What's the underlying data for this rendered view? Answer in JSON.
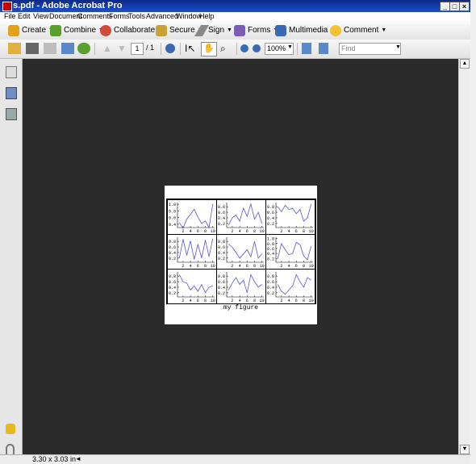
{
  "window": {
    "title": "s.pdf - Adobe Acrobat Pro"
  },
  "menu": [
    "File",
    "Edit",
    "View",
    "Document",
    "Comments",
    "Forms",
    "Tools",
    "Advanced",
    "Window",
    "Help"
  ],
  "toolbar1": {
    "create": "Create",
    "combine": "Combine",
    "collaborate": "Collaborate",
    "secure": "Secure",
    "sign": "Sign",
    "forms": "Forms",
    "multimedia": "Multimedia",
    "comment": "Comment"
  },
  "toolbar2": {
    "page_current": "1",
    "page_total": "/ 1",
    "zoom": "100%",
    "find_placeholder": "Find"
  },
  "status": {
    "page_size": "3.30 x 3.03 in"
  },
  "figure": {
    "caption": "my figure",
    "xticks": [
      "2",
      "4",
      "6",
      "8",
      "10"
    ],
    "line_color": "#5555cc"
  },
  "chart_data": [
    {
      "type": "line",
      "x": [
        1,
        2,
        3,
        4,
        5,
        6,
        7,
        8,
        9,
        10
      ],
      "values": [
        0.45,
        0.28,
        0.55,
        0.7,
        0.85,
        0.62,
        0.42,
        0.5,
        0.3,
        1.0
      ],
      "yticks": [
        "1.0",
        "0.8",
        "0.6",
        "0.4"
      ],
      "ylim": [
        0.3,
        1.05
      ]
    },
    {
      "type": "line",
      "x": [
        1,
        2,
        3,
        4,
        5,
        6,
        7,
        8,
        9,
        10
      ],
      "values": [
        0.15,
        0.4,
        0.5,
        0.28,
        0.75,
        0.45,
        0.9,
        0.35,
        0.6,
        0.2
      ],
      "yticks": [
        "0.8",
        "0.6",
        "0.4",
        "0.2"
      ],
      "ylim": [
        0.05,
        0.95
      ]
    },
    {
      "type": "line",
      "x": [
        1,
        2,
        3,
        4,
        5,
        6,
        7,
        8,
        9,
        10
      ],
      "values": [
        0.8,
        0.62,
        0.85,
        0.7,
        0.74,
        0.55,
        0.7,
        0.28,
        0.4,
        0.9
      ],
      "yticks": [
        "0.8",
        "0.6",
        "0.4",
        "0.2"
      ],
      "ylim": [
        0.05,
        0.95
      ]
    },
    {
      "type": "line",
      "x": [
        1,
        2,
        3,
        4,
        5,
        6,
        7,
        8,
        9,
        10
      ],
      "values": [
        0.2,
        0.88,
        0.3,
        0.82,
        0.15,
        0.7,
        0.2,
        0.85,
        0.25,
        0.9
      ],
      "yticks": [
        "0.8",
        "0.6",
        "0.4",
        "0.2"
      ],
      "ylim": [
        0.05,
        0.95
      ]
    },
    {
      "type": "line",
      "x": [
        1,
        2,
        3,
        4,
        5,
        6,
        7,
        8,
        9,
        10
      ],
      "values": [
        0.7,
        0.6,
        0.4,
        0.2,
        0.35,
        0.5,
        0.25,
        0.8,
        0.2,
        0.35
      ],
      "yticks": [
        "0.8",
        "0.6",
        "0.4",
        "0.2"
      ],
      "ylim": [
        0.05,
        0.95
      ]
    },
    {
      "type": "line",
      "x": [
        1,
        2,
        3,
        4,
        5,
        6,
        7,
        8,
        9,
        10
      ],
      "values": [
        0.2,
        0.8,
        0.55,
        0.35,
        0.4,
        0.85,
        0.75,
        0.3,
        0.15,
        0.7
      ],
      "yticks": [
        "1.0",
        "0.8",
        "0.6",
        "0.4",
        "0.2"
      ],
      "ylim": [
        0.05,
        1.05
      ]
    },
    {
      "type": "line",
      "x": [
        1,
        2,
        3,
        4,
        5,
        6,
        7,
        8,
        9,
        10
      ],
      "values": [
        0.85,
        0.6,
        0.55,
        0.3,
        0.45,
        0.25,
        0.5,
        0.2,
        0.4,
        0.45
      ],
      "yticks": [
        "0.8",
        "0.6",
        "0.4",
        "0.2"
      ],
      "ylim": [
        0.05,
        0.95
      ]
    },
    {
      "type": "line",
      "x": [
        1,
        2,
        3,
        4,
        5,
        6,
        7,
        8,
        9,
        10
      ],
      "values": [
        0.3,
        0.55,
        0.75,
        0.5,
        0.65,
        0.2,
        0.85,
        0.6,
        0.4,
        0.5
      ],
      "yticks": [
        "0.8",
        "0.6",
        "0.4",
        "0.2"
      ],
      "ylim": [
        0.05,
        0.95
      ]
    },
    {
      "type": "line",
      "x": [
        1,
        2,
        3,
        4,
        5,
        6,
        7,
        8,
        9,
        10
      ],
      "values": [
        0.5,
        0.25,
        0.15,
        0.3,
        0.45,
        0.85,
        0.6,
        0.4,
        0.75,
        0.65
      ],
      "yticks": [
        "0.8",
        "0.6",
        "0.4",
        "0.2"
      ],
      "ylim": [
        0.05,
        0.95
      ]
    }
  ]
}
